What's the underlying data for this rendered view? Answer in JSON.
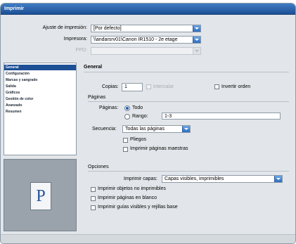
{
  "window": {
    "title": "Imprimir"
  },
  "setup": {
    "preset_label": "Ajuste de impresión:",
    "preset_value": "[Por defecto]",
    "printer_label": "Impresora:",
    "printer_value": "\\\\andarsrv01\\Canon IR1510 - 2e etage",
    "ppd_label": "PPD:",
    "ppd_value": ""
  },
  "sidebar": {
    "items": [
      {
        "label": "General",
        "selected": true
      },
      {
        "label": "Configuración",
        "selected": false
      },
      {
        "label": "Marcas y sangrado",
        "selected": false
      },
      {
        "label": "Salida",
        "selected": false
      },
      {
        "label": "Gráficos",
        "selected": false
      },
      {
        "label": "Gestión de color",
        "selected": false
      },
      {
        "label": "Avanzado",
        "selected": false
      },
      {
        "label": "Resumen",
        "selected": false
      }
    ]
  },
  "preview": {
    "page_letter": "P"
  },
  "general": {
    "heading": "General",
    "copies_label": "Copias:",
    "copies_value": "1",
    "collate_label": "Intercalar",
    "collate_checked": false,
    "reverse_label": "Invertir orden",
    "reverse_checked": false
  },
  "pages": {
    "heading": "Páginas",
    "pages_label": "Páginas:",
    "all_label": "Todo",
    "range_label": "Rango:",
    "range_value": "1-3",
    "sequence_label": "Secuencia:",
    "sequence_value": "Todas las páginas",
    "spreads_label": "Pliegos",
    "spreads_checked": false,
    "master_label": "Imprimir páginas maestras",
    "master_checked": false
  },
  "options": {
    "heading": "Opciones",
    "layers_label": "Imprimir capas:",
    "layers_value": "Capas visibles, imprimibles",
    "nonprinting_label": "Imprimir objetos no imprimibles",
    "nonprinting_checked": false,
    "blank_label": "Imprimir páginas en blanco",
    "blank_checked": false,
    "guides_label": "Imprimir guías visibles y rejillas base",
    "guides_checked": false
  },
  "colors": {
    "accent": "#1d4f95",
    "selection": "#1d5fb5"
  }
}
